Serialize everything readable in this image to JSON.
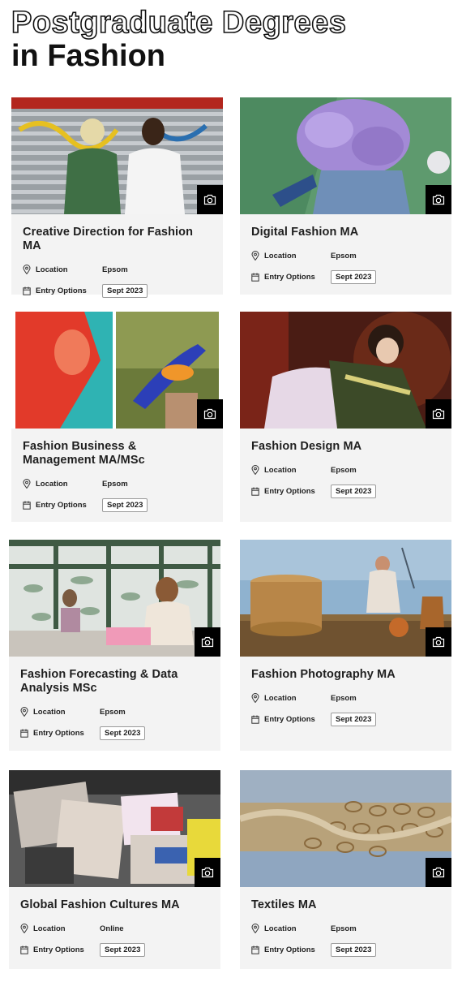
{
  "page": {
    "heading_line1": "Postgraduate Degrees",
    "heading_line2": "in Fashion"
  },
  "labels": {
    "location": "Location",
    "entry_options": "Entry Options"
  },
  "courses": [
    {
      "title": "Creative Direction for Fashion MA",
      "location": "Epsom",
      "entry": "Sept 2023"
    },
    {
      "title": "Digital Fashion MA",
      "location": "Epsom",
      "entry": "Sept 2023"
    },
    {
      "title": "Fashion Business & Management MA/MSc",
      "location": "Epsom",
      "entry": "Sept 2023"
    },
    {
      "title": "Fashion Design MA",
      "location": "Epsom",
      "entry": "Sept 2023"
    },
    {
      "title": "Fashion Forecasting & Data Analysis MSc",
      "location": "Epsom",
      "entry": "Sept 2023"
    },
    {
      "title": "Fashion Photography MA",
      "location": "Epsom",
      "entry": "Sept 2023"
    },
    {
      "title": "Global Fashion Cultures MA",
      "location": "Online",
      "entry": "Sept 2023"
    },
    {
      "title": "Textiles MA",
      "location": "Epsom",
      "entry": "Sept 2023"
    }
  ],
  "icons": {
    "camera": "camera-icon",
    "location": "map-pin-icon",
    "calendar": "calendar-icon"
  }
}
